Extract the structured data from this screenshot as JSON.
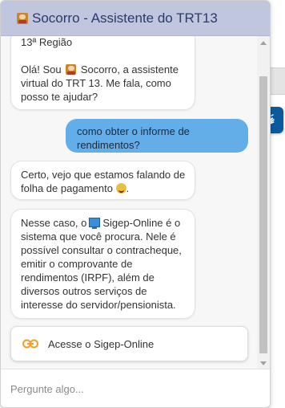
{
  "header": {
    "title": "Socorro - Assistente do TRT13"
  },
  "messages": {
    "bot1": {
      "line0": "13ª Região",
      "line1_pre": "Olá! Sou",
      "line1_post": "Socorro, a assistente",
      "line2": "virtual do TRT 13. Me fala, como",
      "line3": "posso te ajudar?"
    },
    "user1": {
      "line1": "como obter o informe de",
      "line2": "rendimentos?"
    },
    "bot2": {
      "line1": "Certo, vejo que estamos falando de",
      "line2": "folha de pagamento",
      "line2_end": "."
    },
    "bot3": {
      "line1_pre": "Nesse caso, o",
      "line1_post": "Sigep-Online é o",
      "line2": "sistema que você procura. Nele é",
      "line3": "possível consultar o contracheque,",
      "line4": "emitir o comprovante de",
      "line5": "rendimentos (IRPF), além de",
      "line6": "diversos outros serviços de",
      "line7": "interesse do servidor/pensionista."
    },
    "link": {
      "label": "Acesse o Sigep-Online"
    }
  },
  "input": {
    "placeholder": "Pergunte algo..."
  },
  "colors": {
    "header_bg": "#bfc6dd",
    "user_bubble": "#63aee8",
    "link_icon": "#f0a020",
    "a11y_button": "#0a5a9c"
  },
  "icons": {
    "avatar": "robot-avatar-icon",
    "link": "link-icon",
    "a11y": "sign-language-icon"
  }
}
